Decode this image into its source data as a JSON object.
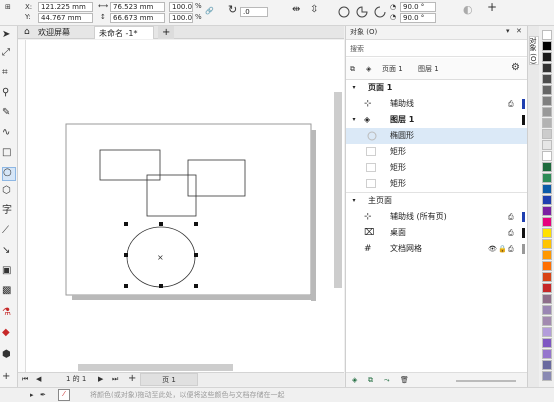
{
  "property_bar": {
    "x_label": "X:",
    "x_value": "121.225 mm",
    "y_label": "Y:",
    "y_value": "44.767 mm",
    "width_value": "76.523 mm",
    "height_value": "66.673 mm",
    "scale_x": "100.0",
    "scale_y": "100.0",
    "percent": "%",
    "rotation": ".0",
    "angle_start": "90.0 °",
    "angle_end": "90.0 °",
    "plus": "+"
  },
  "tabs": {
    "welcome": "欢迎屏幕",
    "document": "未命名 -1*",
    "add": "+"
  },
  "docker": {
    "title": "对象 (O)",
    "search_placeholder": "搜索",
    "page_label": "页面 1",
    "layer_label": "图层 1",
    "tree": {
      "page1": "页面 1",
      "guides": "辅助线",
      "layer1": "图层 1",
      "ellipse": "椭圆形",
      "rect1": "矩形",
      "rect2": "矩形",
      "rect3": "矩形",
      "master": "主页面",
      "master_guides": "辅助线 (所有页)",
      "desktop": "桌面",
      "grid": "文档网格"
    },
    "side_tab": "对象 (O)"
  },
  "page_nav": {
    "counter": "1 的 1",
    "page_tab": "页 1",
    "add": "+"
  },
  "status": {
    "hint": "将颜色(或对象)拖动至此处，以便将这些颜色与文档存储在一起"
  },
  "colors": {
    "guide_blue": "#1f3fb0",
    "layer_black": "#111111",
    "selected_row": "#dbe9f7"
  },
  "palette": [
    "#ffffff",
    "#000000",
    "#1a1a1a",
    "#333333",
    "#4d4d4d",
    "#666666",
    "#808080",
    "#999999",
    "#b3b3b3",
    "#cccccc",
    "#e6e6e6",
    "#ffffff",
    "#1d6a3c",
    "#2e8b57",
    "#0b5aa8",
    "#1f3fb0",
    "#7b1fa2",
    "#e6007e",
    "#ffe100",
    "#ffc400",
    "#ff9800",
    "#ff6f00",
    "#d84315",
    "#c62828",
    "#8e6e8a",
    "#9a86b3",
    "#a28ab0",
    "#b39ddb",
    "#7e57c2",
    "#9575cd",
    "#6a6a9f",
    "#8a8ab3"
  ]
}
